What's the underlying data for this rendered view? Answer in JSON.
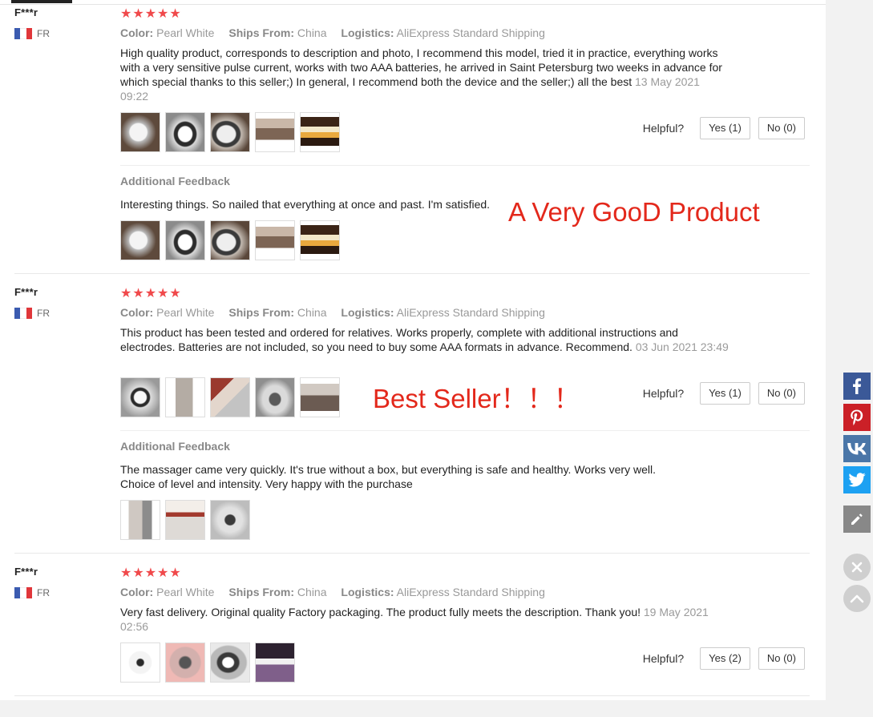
{
  "reviews": [
    {
      "user": "F***r",
      "country": "FR",
      "color_label": "Color:",
      "color_value": "Pearl White",
      "ships_label": "Ships From:",
      "ships_value": "China",
      "logistics_label": "Logistics:",
      "logistics_value": "AliExpress Standard Shipping",
      "text": "High quality product, corresponds to description and photo, I recommend this model, tried it in practice, everything works with a very sensitive pulse current, works with two AAA batteries, he arrived in Saint Petersburg two weeks in advance for which special thanks to this seller;) In general, I recommend both the device and the seller;) all the best",
      "date": "13 May 2021 09:22",
      "helpful_label": "Helpful?",
      "yes_label": "Yes (1)",
      "no_label": "No (0)",
      "additional_title": "Additional Feedback",
      "additional_text": "Interesting things. So nailed that everything at once and past. I'm satisfied."
    },
    {
      "user": "F***r",
      "country": "FR",
      "color_label": "Color:",
      "color_value": "Pearl White",
      "ships_label": "Ships From:",
      "ships_value": "China",
      "logistics_label": "Logistics:",
      "logistics_value": "AliExpress Standard Shipping",
      "text": "This product has been tested and ordered for relatives. Works properly, complete with additional instructions and electrodes. Batteries are not included, so you need to buy some AAA formats in advance. Recommend.",
      "date": "03 Jun 2021 23:49",
      "helpful_label": "Helpful?",
      "yes_label": "Yes (1)",
      "no_label": "No (0)",
      "additional_title": "Additional Feedback",
      "additional_text_1": "The massager came very quickly. It's true without a box, but everything is safe and healthy. Works very well.",
      "additional_text_2": "Choice of level and intensity. Very happy with the purchase"
    },
    {
      "user": "F***r",
      "country": "FR",
      "color_label": "Color:",
      "color_value": "Pearl White",
      "ships_label": "Ships From:",
      "ships_value": "China",
      "logistics_label": "Logistics:",
      "logistics_value": "AliExpress Standard Shipping",
      "text": "Very fast delivery. Original quality Factory packaging. The product fully meets the description. Thank you!",
      "date": "19 May 2021 02:56",
      "helpful_label": "Helpful?",
      "yes_label": "Yes (2)",
      "no_label": "No (0)"
    }
  ],
  "overlays": {
    "promo_1": "A Very GooD Product",
    "promo_2": "Best Seller！！！"
  },
  "rating": {
    "stars": 5,
    "max": 5
  },
  "colors": {
    "star": "#f0494b",
    "promo": "#e3281b",
    "facebook": "#3b5998",
    "pinterest": "#cb2027",
    "vk": "#4a76a8",
    "twitter": "#1da1f2",
    "edit": "#888888"
  },
  "icons": [
    "facebook-icon",
    "pinterest-icon",
    "vk-icon",
    "twitter-icon",
    "edit-icon",
    "close-icon",
    "scroll-top-icon"
  ]
}
